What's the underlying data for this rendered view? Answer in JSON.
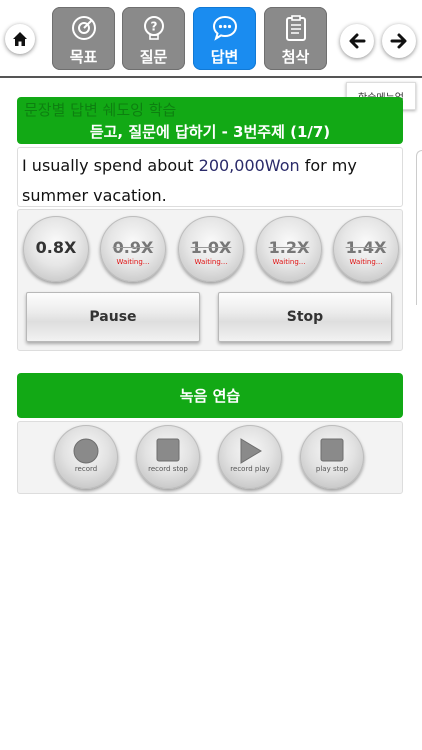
{
  "nav": {
    "tabs": [
      {
        "label": "목표"
      },
      {
        "label": "질문"
      },
      {
        "label": "답변"
      },
      {
        "label": "첨삭"
      }
    ],
    "tooltip": "학습메뉴얼"
  },
  "header": {
    "title": "문장별 답변 쉐도잉 학습",
    "subtitle": "듣고, 질문에 답하기 - 3번주제 (1/7)"
  },
  "sentence": {
    "part1": "I usually spend about ",
    "highlight": "200,000Won",
    "part2": " for my summer vacation."
  },
  "speeds": [
    {
      "label": "0.8X",
      "status": ""
    },
    {
      "label": "0.9X",
      "status": "Waiting..."
    },
    {
      "label": "1.0X",
      "status": "Waiting..."
    },
    {
      "label": "1.2X",
      "status": "Waiting..."
    },
    {
      "label": "1.4X",
      "status": "Waiting..."
    }
  ],
  "controls": {
    "pause": "Pause",
    "stop": "Stop"
  },
  "recording": {
    "title": "녹음 연습",
    "buttons": [
      {
        "label": "record"
      },
      {
        "label": "record stop"
      },
      {
        "label": "record play"
      },
      {
        "label": "play stop"
      }
    ]
  },
  "colors": {
    "accent_green": "#12a915",
    "active_tab": "#1a8cf0",
    "inactive_tab": "#8a8a8a",
    "waiting_red": "#e01010"
  }
}
